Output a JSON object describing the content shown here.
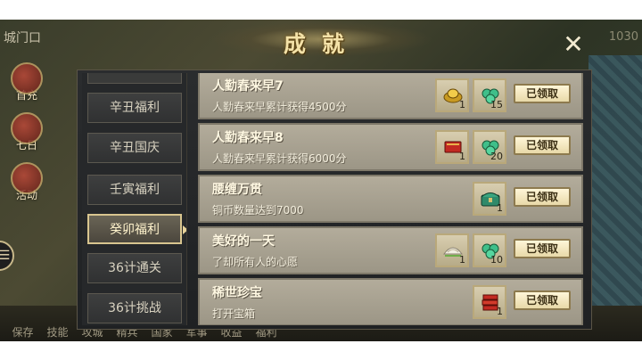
{
  "background": {
    "location_label": "城门口",
    "top_right_value": "1030",
    "side_buttons": [
      "首充",
      "七日",
      "活动"
    ],
    "bottom_menu": [
      "保存",
      "技能",
      "攻城",
      "精兵",
      "国家",
      "军事",
      "收益",
      "福利"
    ]
  },
  "dialog": {
    "title": "成就",
    "close_icon": "close-icon"
  },
  "tabs": [
    {
      "label": "辛丑福利",
      "active": false
    },
    {
      "label": "辛丑国庆",
      "active": false
    },
    {
      "label": "壬寅福利",
      "active": false
    },
    {
      "label": "癸卯福利",
      "active": true
    },
    {
      "label": "36计通关",
      "active": false
    },
    {
      "label": "36计挑战",
      "active": false
    }
  ],
  "achievements": [
    {
      "name": "人勤春来早7",
      "desc": "人勤春来早累计获得4500分",
      "rewards": [
        {
          "icon": "gold-ingot-icon",
          "qty": "1"
        },
        {
          "icon": "jade-coins-icon",
          "qty": "15"
        }
      ],
      "button": "已领取"
    },
    {
      "name": "人勤春来早8",
      "desc": "人勤春来早累计获得6000分",
      "rewards": [
        {
          "icon": "red-book-icon",
          "qty": "1"
        },
        {
          "icon": "jade-coins-icon",
          "qty": "20"
        }
      ],
      "button": "已领取"
    },
    {
      "name": "腰缠万贯",
      "desc": "铜币数量达到7000",
      "rewards": [
        {
          "icon": "treasure-chest-icon",
          "qty": "1"
        }
      ],
      "button": "已领取"
    },
    {
      "name": "美好的一天",
      "desc": "了却所有人的心愿",
      "rewards": [
        {
          "icon": "dumpling-icon",
          "qty": "1"
        },
        {
          "icon": "jade-coins-icon",
          "qty": "10"
        }
      ],
      "button": "已领取"
    },
    {
      "name": "稀世珍宝",
      "desc": "打开宝箱",
      "rewards": [
        {
          "icon": "red-book-stack-icon",
          "qty": "1"
        }
      ],
      "button": "已领取"
    }
  ],
  "colors": {
    "title_gold": "#f4e2a8",
    "row_bg": "#b3ac9b",
    "button_bg": "#fff6d8",
    "tab_active_border": "#d8c58f"
  }
}
